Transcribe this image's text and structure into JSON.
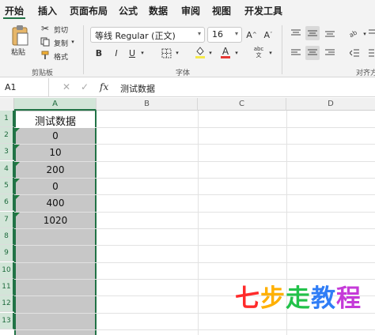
{
  "tabs": [
    "开始",
    "插入",
    "页面布局",
    "公式",
    "数据",
    "审阅",
    "视图",
    "开发工具"
  ],
  "clipboard": {
    "paste_label": "粘贴",
    "cut_label": "剪切",
    "copy_label": "复制",
    "format_label": "格式",
    "group_label": "剪贴板"
  },
  "font": {
    "name": "等线 Regular (正文)",
    "size": "16",
    "grow_label": "A^",
    "shrink_label": "A˅",
    "bold_label": "B",
    "italic_label": "I",
    "underline_label": "U",
    "color_label": "A",
    "phonetic_label": "abc\n文",
    "group_label": "字体"
  },
  "align": {
    "group_label": "对齐方"
  },
  "formula_bar": {
    "cell_ref": "A1",
    "fx_label": "fx",
    "content": "测试数据"
  },
  "grid": {
    "columns": [
      "A",
      "B",
      "C",
      "D"
    ],
    "rows": [
      "1",
      "2",
      "3",
      "4",
      "5",
      "6",
      "7",
      "8",
      "9",
      "10",
      "11",
      "12",
      "13"
    ],
    "colA": [
      "测试数据",
      "0",
      "10",
      "200",
      "0",
      "400",
      "1020",
      "",
      "",
      "",
      "",
      "",
      ""
    ]
  },
  "watermark": {
    "chars": [
      "七",
      "步",
      "走",
      "教",
      "程"
    ],
    "colors": [
      "#ff2b2b",
      "#ffb000",
      "#22c24a",
      "#2f7df6",
      "#c53ad8"
    ]
  },
  "colors": {
    "accent": "#217346",
    "selection": "#c7c7c7"
  }
}
